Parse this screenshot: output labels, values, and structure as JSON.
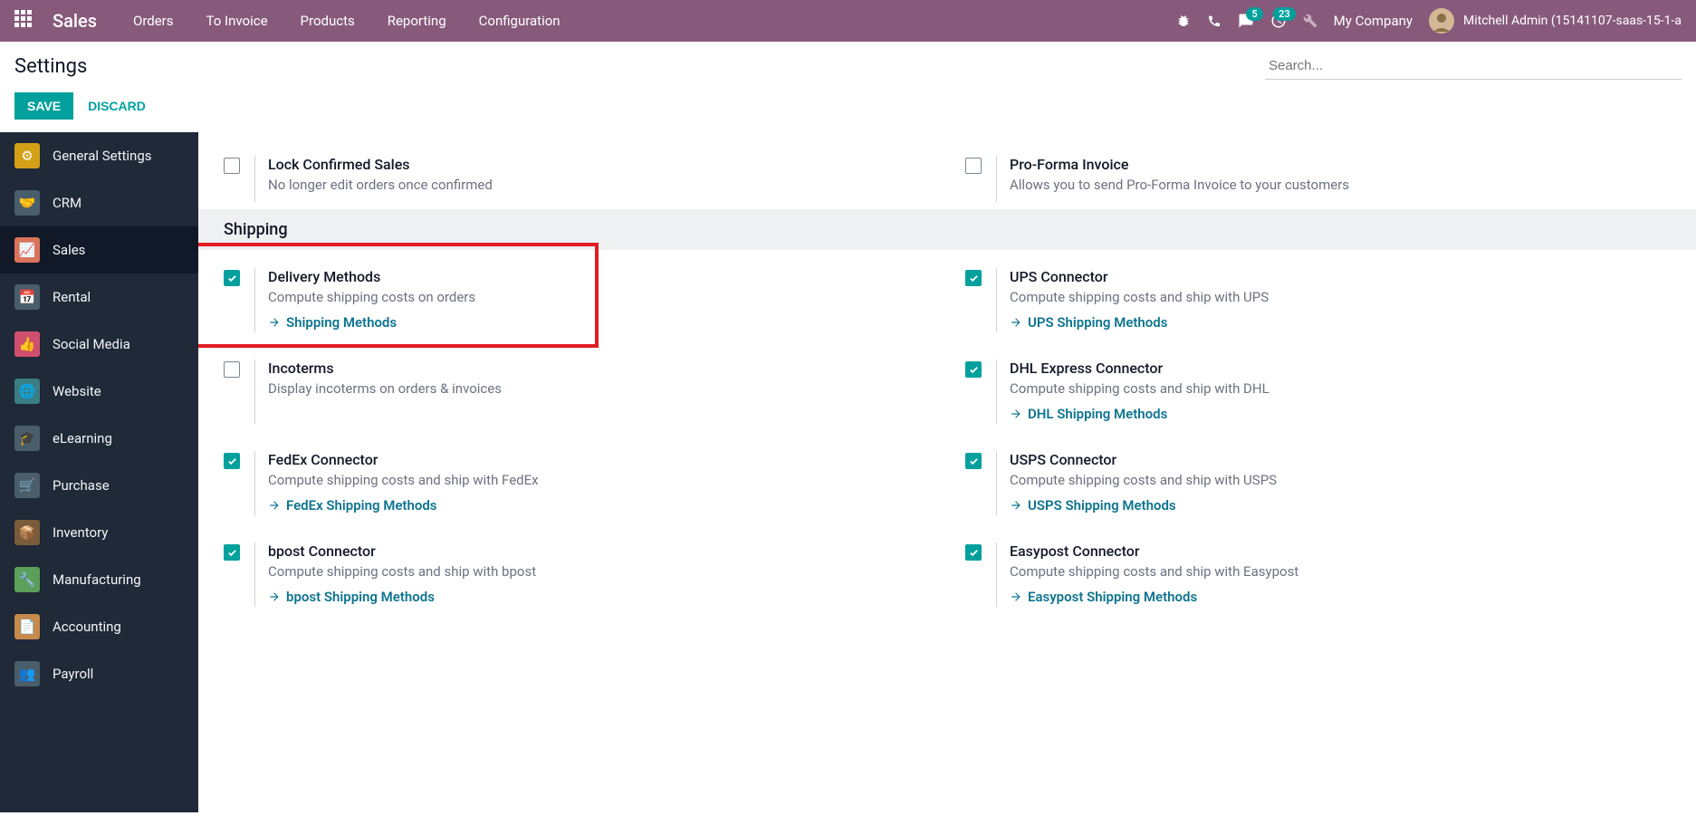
{
  "navbar": {
    "brand": "Sales",
    "menu": [
      "Orders",
      "To Invoice",
      "Products",
      "Reporting",
      "Configuration"
    ],
    "msg_badge": "5",
    "activity_badge": "23",
    "company": "My Company",
    "user": "Mitchell Admin (15141107-saas-15-1-a"
  },
  "topbar": {
    "title": "Settings",
    "search_placeholder": "Search..."
  },
  "actions": {
    "save": "SAVE",
    "discard": "DISCARD"
  },
  "sidebar": [
    {
      "label": "General Settings",
      "color": "#d4a017"
    },
    {
      "label": "CRM",
      "color": "#4a5d6b"
    },
    {
      "label": "Sales",
      "color": "#d9735a",
      "active": true
    },
    {
      "label": "Rental",
      "color": "#4a5d6b"
    },
    {
      "label": "Social Media",
      "color": "#d04f6f"
    },
    {
      "label": "Website",
      "color": "#3a7d82"
    },
    {
      "label": "eLearning",
      "color": "#4a5d6b"
    },
    {
      "label": "Purchase",
      "color": "#4a5d6b"
    },
    {
      "label": "Inventory",
      "color": "#7a5b3a"
    },
    {
      "label": "Manufacturing",
      "color": "#5aa05a"
    },
    {
      "label": "Accounting",
      "color": "#c78a4a"
    },
    {
      "label": "Payroll",
      "color": "#4a5d6b"
    }
  ],
  "pre_section": {
    "left": {
      "title": "Lock Confirmed Sales",
      "desc": "No longer edit orders once confirmed",
      "checked": false
    },
    "right": {
      "title": "Pro-Forma Invoice",
      "desc": "Allows you to send Pro-Forma Invoice to your customers",
      "checked": false
    }
  },
  "section_title": "Shipping",
  "shipping": [
    {
      "title": "Delivery Methods",
      "desc": "Compute shipping costs on orders",
      "link": "Shipping Methods",
      "checked": true
    },
    {
      "title": "UPS Connector",
      "desc": "Compute shipping costs and ship with UPS",
      "link": "UPS Shipping Methods",
      "checked": true
    },
    {
      "title": "Incoterms",
      "desc": "Display incoterms on orders & invoices",
      "link": null,
      "checked": false
    },
    {
      "title": "DHL Express Connector",
      "desc": "Compute shipping costs and ship with DHL",
      "link": "DHL Shipping Methods",
      "checked": true
    },
    {
      "title": "FedEx Connector",
      "desc": "Compute shipping costs and ship with FedEx",
      "link": "FedEx Shipping Methods",
      "checked": true
    },
    {
      "title": "USPS Connector",
      "desc": "Compute shipping costs and ship with USPS",
      "link": "USPS Shipping Methods",
      "checked": true
    },
    {
      "title": "bpost Connector",
      "desc": "Compute shipping costs and ship with bpost",
      "link": "bpost Shipping Methods",
      "checked": true
    },
    {
      "title": "Easypost Connector",
      "desc": "Compute shipping costs and ship with Easypost",
      "link": "Easypost Shipping Methods",
      "checked": true
    }
  ]
}
